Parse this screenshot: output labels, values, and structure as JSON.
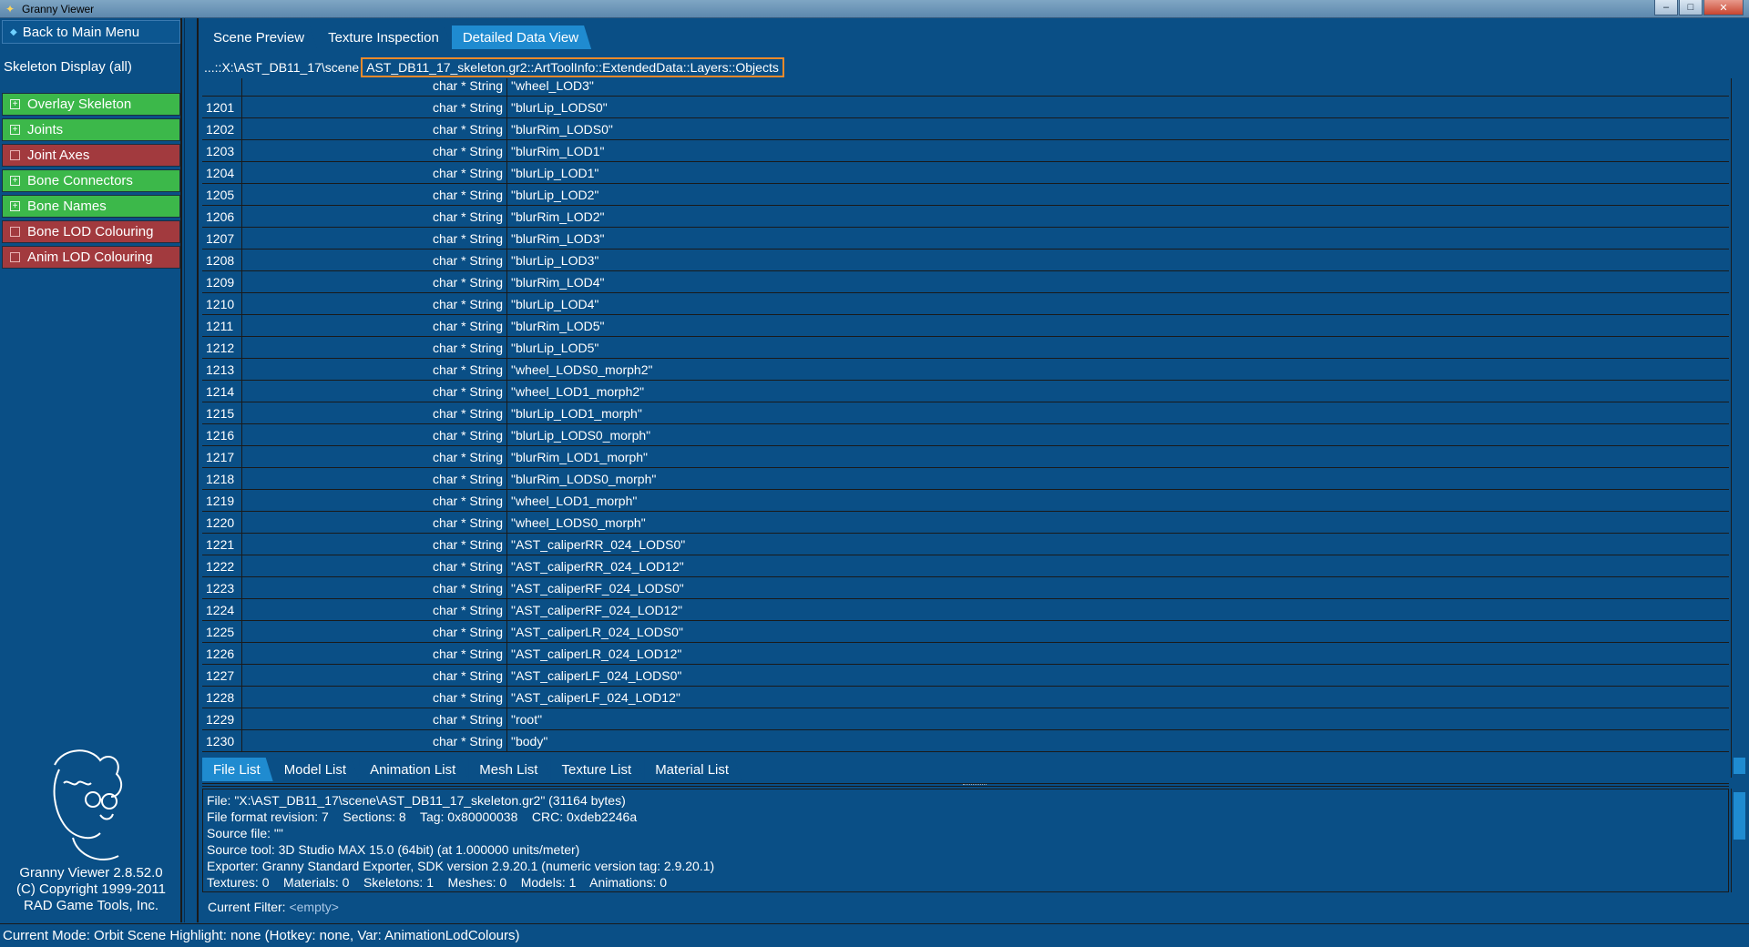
{
  "window": {
    "title": "Granny Viewer",
    "minimize": "–",
    "maximize": "□",
    "close": "✕"
  },
  "sidebar": {
    "back_label": "Back to Main Menu",
    "section_label": "Skeleton Display (all)",
    "options": [
      {
        "label": "Overlay Skeleton",
        "state": "on"
      },
      {
        "label": "Joints",
        "state": "on"
      },
      {
        "label": "Joint Axes",
        "state": "off"
      },
      {
        "label": "Bone Connectors",
        "state": "on"
      },
      {
        "label": "Bone Names",
        "state": "on"
      },
      {
        "label": "Bone LOD Colouring",
        "state": "off"
      },
      {
        "label": "Anim LOD Colouring",
        "state": "off"
      }
    ],
    "about": {
      "version": "Granny Viewer 2.8.52.0",
      "copyright": "(C) Copyright 1999-2011",
      "company": "RAD Game Tools, Inc."
    }
  },
  "top_tabs": [
    "Scene Preview",
    "Texture Inspection",
    "Detailed Data View"
  ],
  "active_top_tab": 2,
  "path": {
    "prefix": "...::X:\\AST_DB11_17\\scene",
    "highlighted": "AST_DB11_17_skeleton.gr2::ArtToolInfo::ExtendedData::Layers::Objects"
  },
  "rows": [
    {
      "idx": "",
      "type": "char * String",
      "value": "\"wheel_LOD3\""
    },
    {
      "idx": "1201",
      "type": "char * String",
      "value": "\"blurLip_LODS0\""
    },
    {
      "idx": "1202",
      "type": "char * String",
      "value": "\"blurRim_LODS0\""
    },
    {
      "idx": "1203",
      "type": "char * String",
      "value": "\"blurRim_LOD1\""
    },
    {
      "idx": "1204",
      "type": "char * String",
      "value": "\"blurLip_LOD1\""
    },
    {
      "idx": "1205",
      "type": "char * String",
      "value": "\"blurLip_LOD2\""
    },
    {
      "idx": "1206",
      "type": "char * String",
      "value": "\"blurRim_LOD2\""
    },
    {
      "idx": "1207",
      "type": "char * String",
      "value": "\"blurRim_LOD3\""
    },
    {
      "idx": "1208",
      "type": "char * String",
      "value": "\"blurLip_LOD3\""
    },
    {
      "idx": "1209",
      "type": "char * String",
      "value": "\"blurRim_LOD4\""
    },
    {
      "idx": "1210",
      "type": "char * String",
      "value": "\"blurLip_LOD4\""
    },
    {
      "idx": "1211",
      "type": "char * String",
      "value": "\"blurRim_LOD5\""
    },
    {
      "idx": "1212",
      "type": "char * String",
      "value": "\"blurLip_LOD5\""
    },
    {
      "idx": "1213",
      "type": "char * String",
      "value": "\"wheel_LODS0_morph2\""
    },
    {
      "idx": "1214",
      "type": "char * String",
      "value": "\"wheel_LOD1_morph2\""
    },
    {
      "idx": "1215",
      "type": "char * String",
      "value": "\"blurLip_LOD1_morph\""
    },
    {
      "idx": "1216",
      "type": "char * String",
      "value": "\"blurLip_LODS0_morph\""
    },
    {
      "idx": "1217",
      "type": "char * String",
      "value": "\"blurRim_LOD1_morph\""
    },
    {
      "idx": "1218",
      "type": "char * String",
      "value": "\"blurRim_LODS0_morph\""
    },
    {
      "idx": "1219",
      "type": "char * String",
      "value": "\"wheel_LOD1_morph\""
    },
    {
      "idx": "1220",
      "type": "char * String",
      "value": "\"wheel_LODS0_morph\""
    },
    {
      "idx": "1221",
      "type": "char * String",
      "value": "\"AST_caliperRR_024_LODS0\""
    },
    {
      "idx": "1222",
      "type": "char * String",
      "value": "\"AST_caliperRR_024_LOD12\""
    },
    {
      "idx": "1223",
      "type": "char * String",
      "value": "\"AST_caliperRF_024_LODS0\""
    },
    {
      "idx": "1224",
      "type": "char * String",
      "value": "\"AST_caliperRF_024_LOD12\""
    },
    {
      "idx": "1225",
      "type": "char * String",
      "value": "\"AST_caliperLR_024_LODS0\""
    },
    {
      "idx": "1226",
      "type": "char * String",
      "value": "\"AST_caliperLR_024_LOD12\""
    },
    {
      "idx": "1227",
      "type": "char * String",
      "value": "\"AST_caliperLF_024_LODS0\""
    },
    {
      "idx": "1228",
      "type": "char * String",
      "value": "\"AST_caliperLF_024_LOD12\""
    },
    {
      "idx": "1229",
      "type": "char * String",
      "value": "\"root\""
    },
    {
      "idx": "1230",
      "type": "char * String",
      "value": "\"body\""
    }
  ],
  "bottom_tabs": [
    "File List",
    "Model List",
    "Animation List",
    "Mesh List",
    "Texture List",
    "Material List"
  ],
  "active_bottom_tab": 0,
  "info_lines": [
    "File: \"X:\\AST_DB11_17\\scene\\AST_DB11_17_skeleton.gr2\" (31164 bytes)",
    "File format revision: 7    Sections: 8    Tag: 0x80000038    CRC: 0xdeb2246a",
    "Source file: \"\"",
    "Source tool: 3D Studio MAX 15.0 (64bit) (at 1.000000 units/meter)",
    "Exporter: Granny Standard Exporter, SDK version 2.9.20.1 (numeric version tag: 2.9.20.1)",
    "Textures: 0    Materials: 0    Skeletons: 1    Meshes: 0    Models: 1    Animations: 0"
  ],
  "filter": {
    "label": "Current Filter:",
    "value": "<empty>"
  },
  "status": "Current Mode: Orbit Scene   Highlight: none (Hotkey: none, Var: AnimationLodColours)",
  "colors": {
    "accent": "#1f8bd0",
    "on": "#3cb84a",
    "off": "#a23a3e",
    "highlight": "#f08a2a",
    "bg": "#0a4f86"
  }
}
